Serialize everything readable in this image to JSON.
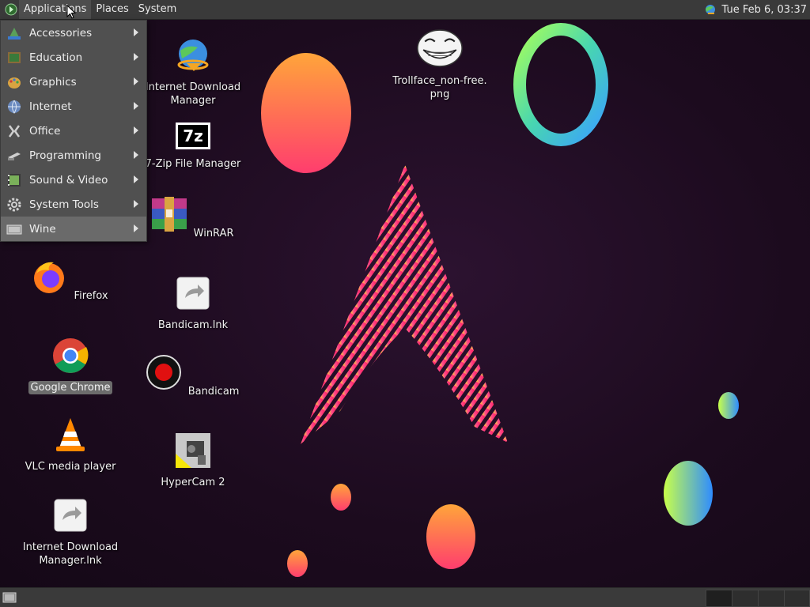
{
  "top_panel": {
    "menus": [
      "Applications",
      "Places",
      "System"
    ],
    "clock": "Tue Feb  6, 03:37"
  },
  "app_menu": {
    "items": [
      {
        "label": "Accessories",
        "icon": "accessories-icon"
      },
      {
        "label": "Education",
        "icon": "education-icon"
      },
      {
        "label": "Graphics",
        "icon": "graphics-icon"
      },
      {
        "label": "Internet",
        "icon": "internet-globe-icon"
      },
      {
        "label": "Office",
        "icon": "office-icon"
      },
      {
        "label": "Programming",
        "icon": "programming-icon"
      },
      {
        "label": "Sound & Video",
        "icon": "sound-video-icon"
      },
      {
        "label": "System Tools",
        "icon": "system-tools-gear-icon"
      },
      {
        "label": "Wine",
        "icon": "wine-icon"
      }
    ],
    "hovered": "Wine"
  },
  "desktop": {
    "icons_col1": [
      {
        "label": "Firefox",
        "icon": "firefox-icon"
      },
      {
        "label": "Google Chrome",
        "icon": "chrome-icon",
        "selected": true
      },
      {
        "label": "VLC media player",
        "icon": "vlc-icon"
      },
      {
        "label": "Internet Download\nManager.lnk",
        "icon": "shortcut-icon"
      }
    ],
    "icons_col2": [
      {
        "label": "Internet Download\nManager",
        "icon": "idm-icon"
      },
      {
        "label": "7-Zip File Manager",
        "icon": "7zip-icon"
      },
      {
        "label": "WinRAR",
        "icon": "winrar-icon"
      },
      {
        "label": "Bandicam.lnk",
        "icon": "shortcut-icon"
      },
      {
        "label": "Bandicam",
        "icon": "bandicam-icon"
      },
      {
        "label": "HyperCam 2",
        "icon": "hypercam-icon"
      }
    ],
    "file_icon": {
      "label": "Trollface_non-free.\npng",
      "icon": "trollface-image-icon"
    }
  },
  "icons": {
    "zip_glyph": "7z"
  },
  "colors": {
    "panel": "#3a3a3a",
    "menu": "#505050",
    "menu_hover": "#6a6a6a"
  }
}
